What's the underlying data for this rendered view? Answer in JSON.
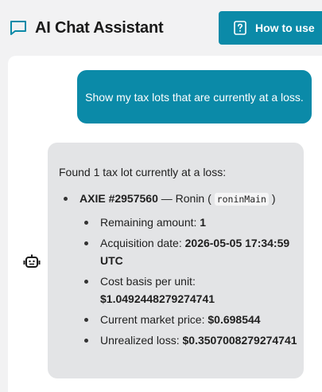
{
  "header": {
    "title": "AI Chat Assistant",
    "how_to_use_label": "How to use"
  },
  "messages": {
    "user": "Show my tax lots that are currently at a loss.",
    "bot": {
      "intro": "Found 1 tax lot currently at a loss:",
      "asset_name": "AXIE #2957560",
      "separator": " — Ronin (",
      "wallet_code": "roninMain",
      "close_paren": ")",
      "details": [
        {
          "label": "Remaining amount: ",
          "value": "1"
        },
        {
          "label": "Acquisition date: ",
          "value": "2026-05-05 17:34:59 UTC"
        },
        {
          "label": "Cost basis per unit: ",
          "value": "$1.0492448279274741"
        },
        {
          "label": "Current market price: ",
          "value": "$0.698544"
        },
        {
          "label": "Unrealized loss: ",
          "value": "$0.3507008279274741"
        }
      ]
    }
  },
  "colors": {
    "accent": "#0b8aa8",
    "bot_bubble": "#e3e4e6",
    "background": "#f2f2f3"
  },
  "icons": {
    "header": "chat-bubble-icon",
    "button": "question-mark-icon",
    "bot_avatar": "robot-icon"
  }
}
